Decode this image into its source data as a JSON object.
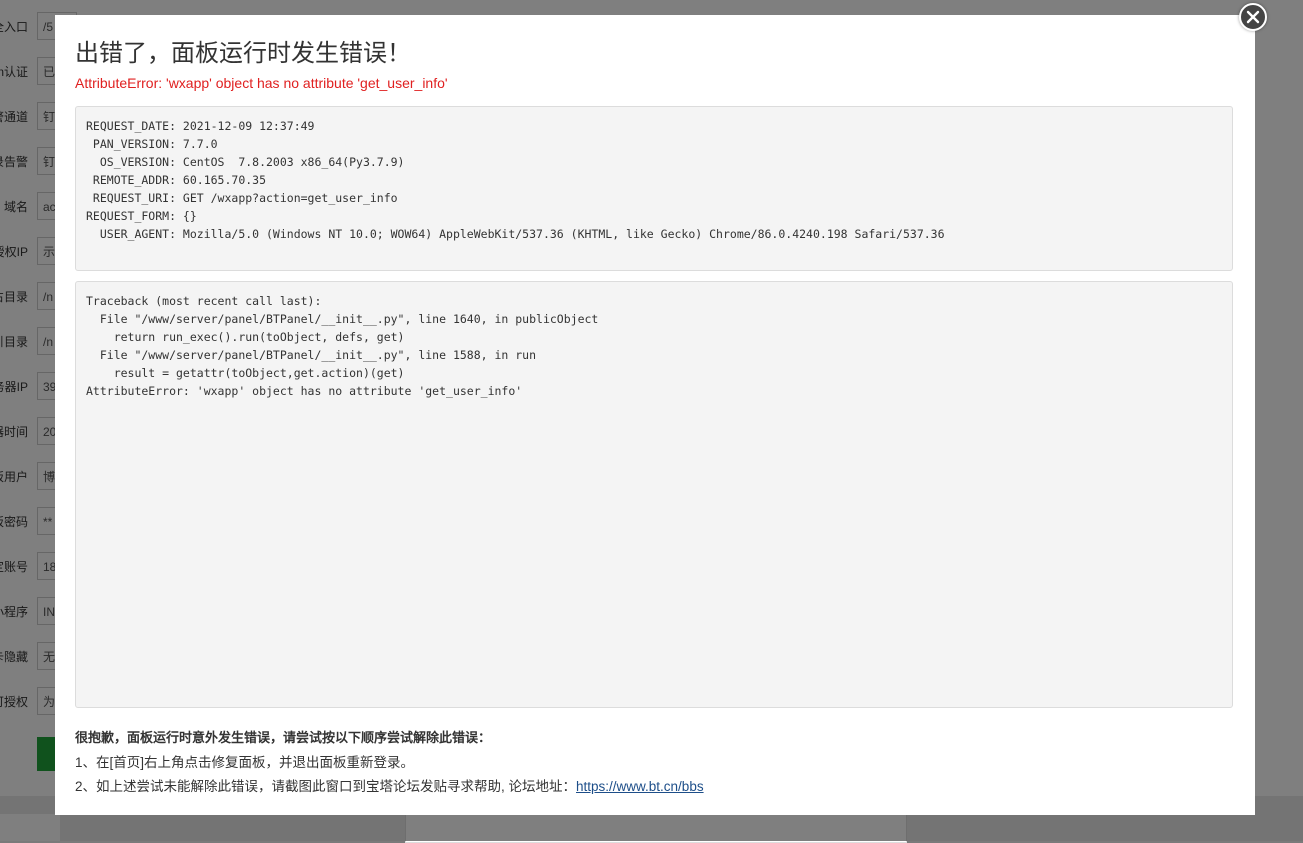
{
  "background": {
    "rows": [
      {
        "label": "全入口",
        "value": "/5"
      },
      {
        "label": "n认证",
        "value": "已"
      },
      {
        "label": "警通道",
        "value": "钉"
      },
      {
        "label": "录告警",
        "value": "钉"
      },
      {
        "label": "域名",
        "value": "ac"
      },
      {
        "label": "授权IP",
        "value": "示"
      },
      {
        "label": "占目录",
        "value": "/n"
      },
      {
        "label": "引目录",
        "value": "/n"
      },
      {
        "label": "务器IP",
        "value": "39"
      },
      {
        "label": "器时间",
        "value": "20"
      },
      {
        "label": "板用户",
        "value": "博"
      },
      {
        "label": "板密码",
        "value": "**"
      },
      {
        "label": "定账号",
        "value": "18"
      },
      {
        "label": "小程序",
        "value": "IN"
      },
      {
        "label": "卡隐藏",
        "value": "无"
      },
      {
        "label": "可授权",
        "value": "为"
      }
    ]
  },
  "dialog": {
    "title": "出错了，面板运行时发生错误！",
    "error_summary": "AttributeError: 'wxapp' object has no attribute 'get_user_info'",
    "request_info": [
      "REQUEST_DATE: 2021-12-09 12:37:49",
      " PAN_VERSION: 7.7.0",
      "  OS_VERSION: CentOS  7.8.2003 x86_64(Py3.7.9)",
      " REMOTE_ADDR: 60.165.70.35",
      " REQUEST_URI: GET /wxapp?action=get_user_info",
      "REQUEST_FORM: {}",
      "  USER_AGENT: Mozilla/5.0 (Windows NT 10.0; WOW64) AppleWebKit/537.36 (KHTML, like Gecko) Chrome/86.0.4240.198 Safari/537.36"
    ],
    "traceback": [
      "Traceback (most recent call last):",
      "  File \"/www/server/panel/BTPanel/__init__.py\", line 1640, in publicObject",
      "    return run_exec().run(toObject, defs, get)",
      "  File \"/www/server/panel/BTPanel/__init__.py\", line 1588, in run",
      "    result = getattr(toObject,get.action)(get)",
      "AttributeError: 'wxapp' object has no attribute 'get_user_info'"
    ],
    "help_heading": "很抱歉，面板运行时意外发生错误，请尝试按以下顺序尝试解除此错误：",
    "help_line1": "1、在[首页]右上角点击修复面板，并退出面板重新登录。",
    "help_line2_prefix": "2、如上述尝试未能解除此错误，请截图此窗口到宝塔论坛发贴寻求帮助, 论坛地址：",
    "forum_link": "https://www.bt.cn/bbs",
    "close_icon": "close-icon"
  },
  "colors": {
    "error_red": "#e02020",
    "link_blue": "#1d4e89",
    "accent_green": "#20a53a"
  }
}
